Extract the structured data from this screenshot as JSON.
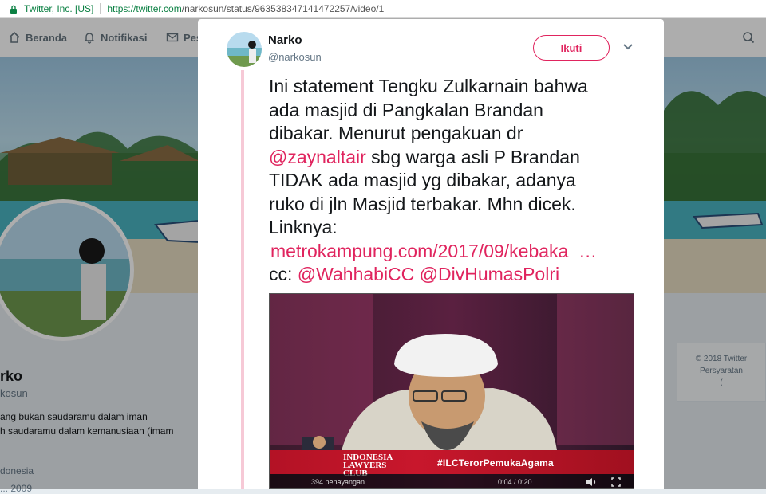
{
  "browser": {
    "secure_label": "Twitter, Inc. [US]",
    "url_host": "https://twitter.com",
    "url_path": "/narkosun/status/963538347141472257/video/1"
  },
  "nav": {
    "home": "Beranda",
    "notifications": "Notifikasi",
    "messages_partial": "Pes"
  },
  "profile": {
    "name_partial": "rko",
    "handle_partial": "kosun",
    "bio_line1": "ang bukan saudaramu dalam iman",
    "bio_line2": "h saudaramu dalam kemanusiaan (imam",
    "location_partial": "donesia",
    "joined_partial": "...  2009"
  },
  "footer": {
    "copyright": "© 2018 Twitter",
    "terms": "Persyaratan",
    "more": "("
  },
  "tweet": {
    "author_name": "Narko",
    "author_handle": "@narkosun",
    "follow_label": "Ikuti",
    "line1": "Ini statement Tengku Zulkarnain bahwa",
    "line2": "ada masjid di Pangkalan Brandan",
    "line3": "dibakar. Menurut pengakuan dr",
    "mention1": "@zaynaltair",
    "line4_rest": " sbg warga asli P Brandan",
    "line5": "TIDAK ada masjid yg dibakar, adanya",
    "line6": "ruko di jln Masjid terbakar. Mhn dicek.",
    "line7": "Linknya:",
    "link": "metrokampung.com/2017/09/kebaka  …",
    "cc_prefix": "cc: ",
    "mention2": "@WahhabiCC",
    "mention3": "@DivHumasPolri"
  },
  "video": {
    "logo_line1": "INDONESIA",
    "logo_line2": "LAWYERS",
    "logo_line3": "CLUB",
    "hashtag": "#ILCTerorPemukaAgama",
    "views": "394 penayangan",
    "time": "0:04 / 0:20"
  },
  "colors": {
    "accent": "#e0245e",
    "thread": "#f6c9d6",
    "secure": "#0b8043"
  }
}
